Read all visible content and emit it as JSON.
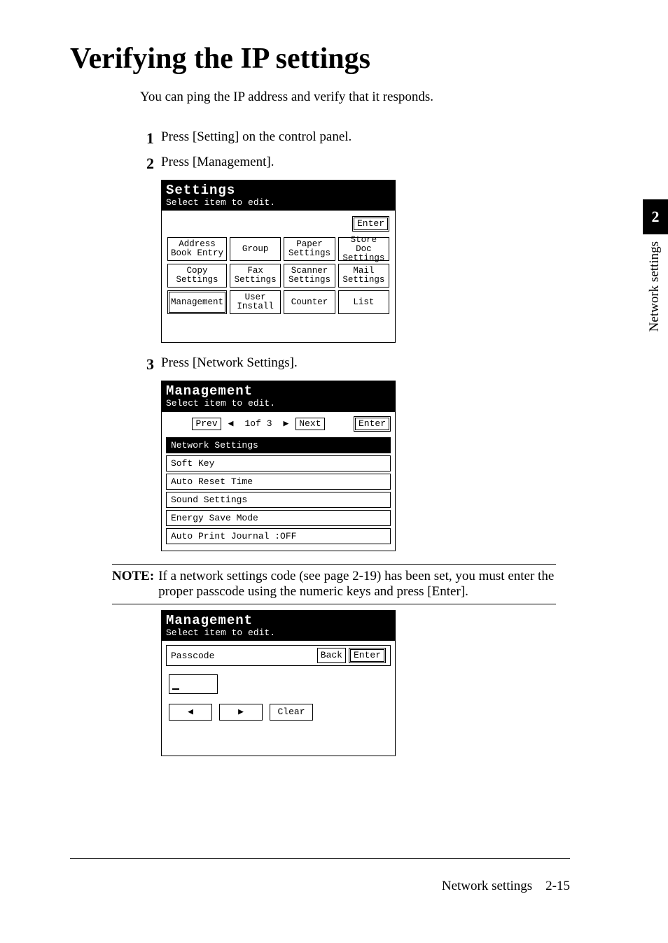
{
  "title": "Verifying the IP settings",
  "intro": "You can ping the IP address and verify that it responds.",
  "steps": {
    "1": "Press [Setting] on the control panel.",
    "2": "Press [Management].",
    "3": "Press [Network Settings]."
  },
  "side": {
    "chapter": "2",
    "label": "Network settings"
  },
  "footer": {
    "section": "Network settings",
    "page": "2-15"
  },
  "note": {
    "label": "NOTE:",
    "text": "If a network settings code (see page 2-19) has been set, you must enter the proper passcode using the numeric keys and press [Enter]."
  },
  "lcd1": {
    "title": "Settings",
    "sub": "Select item to edit.",
    "enter": "Enter",
    "buttons": [
      "Address Book Entry",
      "Group",
      "Paper Settings",
      "Store Doc Settings",
      "Copy Settings",
      "Fax Settings",
      "Scanner Settings",
      "Mail Settings",
      "Management",
      "User Install",
      "Counter",
      "List"
    ]
  },
  "lcd2": {
    "title": "Management",
    "sub": "Select item to edit.",
    "prev": "Prev",
    "next": "Next",
    "enter": "Enter",
    "pager": "1of 3",
    "items": [
      "Network Settings",
      "Soft Key",
      "Auto Reset Time",
      "Sound Settings",
      "Energy Save Mode",
      "Auto Print Journal  :OFF"
    ]
  },
  "lcd3": {
    "title": "Management",
    "sub": "Select item to edit.",
    "field_label": "Passcode",
    "back": "Back",
    "enter": "Enter",
    "clear": "Clear"
  }
}
